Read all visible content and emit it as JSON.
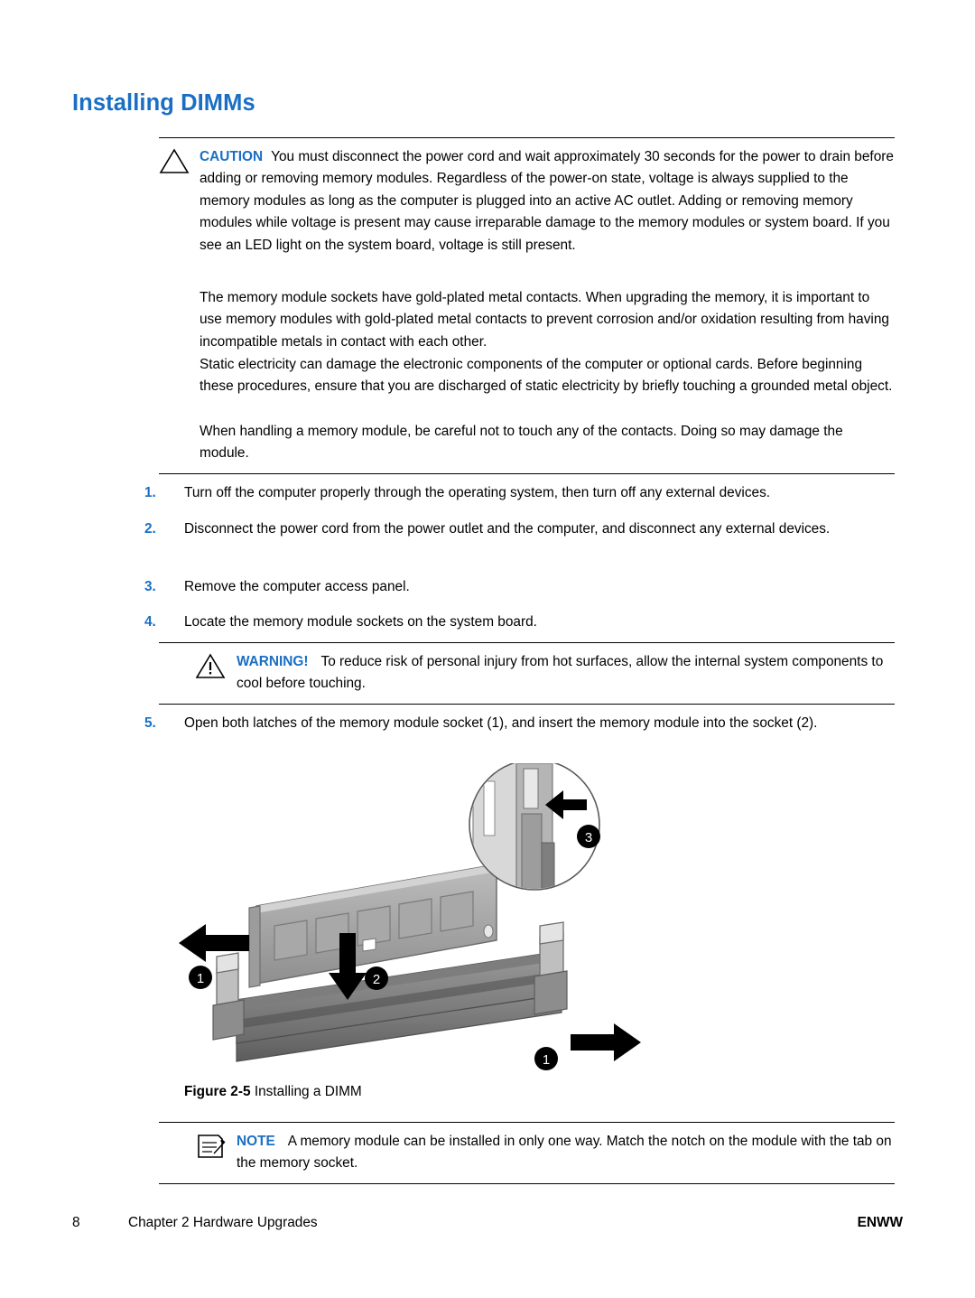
{
  "page": {
    "title": "Installing DIMMs",
    "caution": {
      "label": "CAUTION",
      "text": "You must disconnect the power cord and wait approximately 30 seconds for the power to drain before adding or removing memory modules. Regardless of the power-on state, voltage is always supplied to the memory modules as long as the computer is plugged into an active AC outlet. Adding or removing memory modules while voltage is present may cause irreparable damage to the memory modules or system board. If you see an LED light on the system board, voltage is still present.",
      "para2": "The memory module sockets have gold-plated metal contacts. When upgrading the memory, it is important to use memory modules with gold-plated metal contacts to prevent corrosion and/or oxidation resulting from having incompatible metals in contact with each other.",
      "para3": "Static electricity can damage the electronic components of the computer or optional cards. Before beginning these procedures, ensure that you are discharged of static electricity by briefly touching a grounded metal object.",
      "para4": "When handling a memory module, be careful not to touch any of the contacts. Doing so may damage the module."
    },
    "steps": [
      {
        "num": "1.",
        "text": "Turn off the computer properly through the operating system, then turn off any external devices."
      },
      {
        "num": "2.",
        "text": "Disconnect the power cord from the power outlet and the computer, and disconnect any external devices."
      },
      {
        "num": "3.",
        "text": "Remove the computer access panel."
      },
      {
        "num": "4.",
        "text": "Locate the memory module sockets on the system board."
      },
      {
        "num": "5.",
        "text": "Open both latches of the memory module socket (1), and insert the memory module into the socket (2)."
      }
    ],
    "warning": {
      "label": "WARNING!",
      "text": "To reduce risk of personal injury from hot surfaces, allow the internal system components to cool before touching."
    },
    "figure": {
      "label": "Figure 2-5",
      "label_bold": "Figure 2-5",
      "caption": "Installing a DIMM",
      "callouts": [
        "1",
        "2",
        "3",
        "1"
      ]
    },
    "note": {
      "label": "NOTE",
      "text": "A memory module can be installed in only one way. Match the notch on the module with the tab on the memory socket."
    },
    "footer": {
      "page_number": "8",
      "chapter": "Chapter 2   Hardware Upgrades",
      "right": "ENWW"
    },
    "colors": {
      "accent": "#1a6fc4",
      "text": "#000000"
    }
  }
}
